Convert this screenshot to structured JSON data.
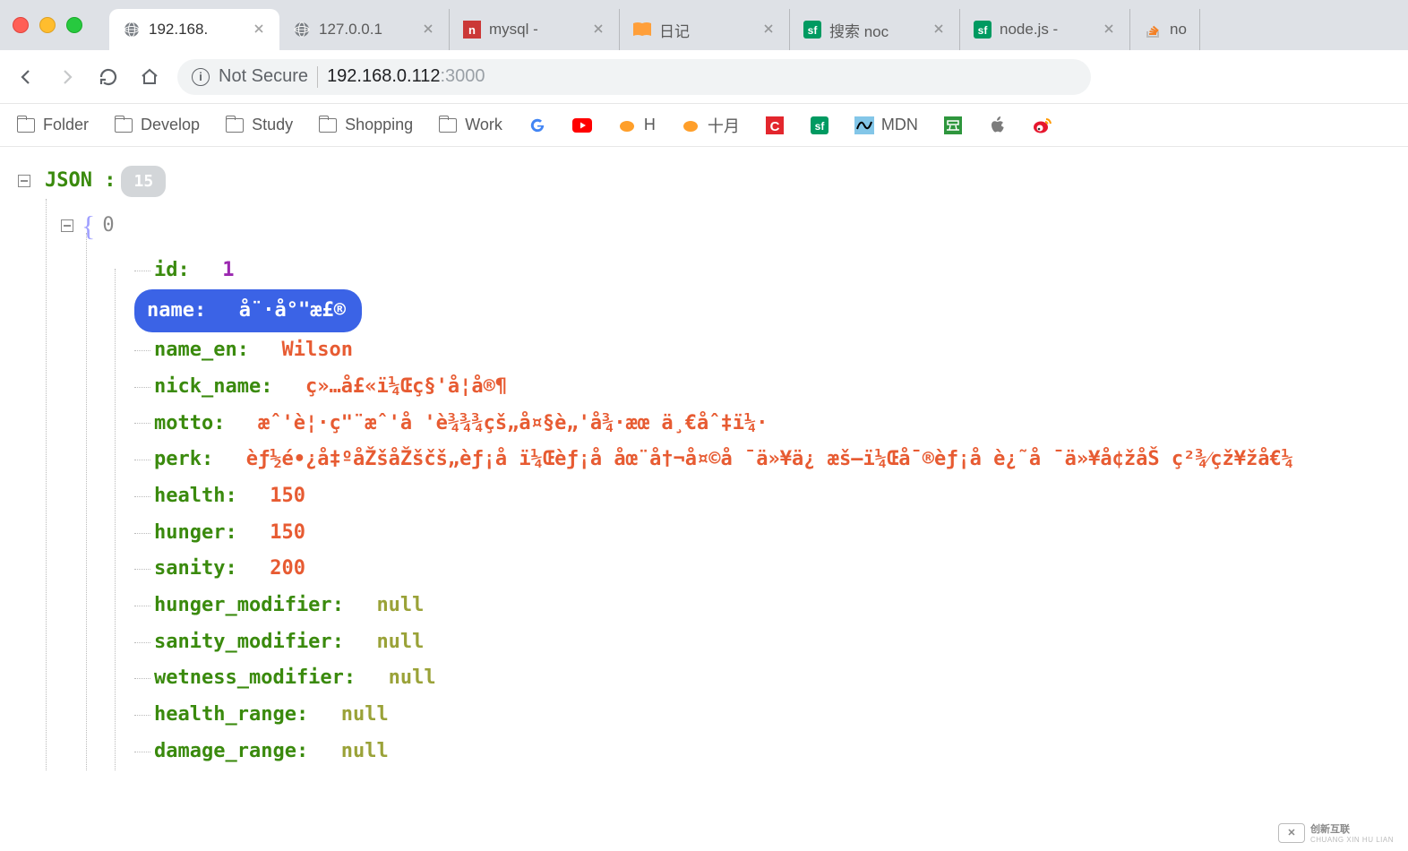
{
  "window": {
    "tabs": [
      {
        "title": "192.168.",
        "active": true,
        "favicon": "globe"
      },
      {
        "title": "127.0.0.1",
        "favicon": "globe"
      },
      {
        "title": "mysql -",
        "favicon": "npm"
      },
      {
        "title": "日记",
        "favicon": "book"
      },
      {
        "title": "搜索 noc",
        "favicon": "sf"
      },
      {
        "title": "node.js -",
        "favicon": "sf"
      },
      {
        "title": "no",
        "favicon": "so",
        "short": true
      }
    ]
  },
  "addressbar": {
    "not_secure": "Not Secure",
    "host": "192.168.0.112",
    "port": ":3000"
  },
  "bookmarks": [
    {
      "label": "Folder",
      "icon": "folder"
    },
    {
      "label": "Develop",
      "icon": "folder"
    },
    {
      "label": "Study",
      "icon": "folder"
    },
    {
      "label": "Shopping",
      "icon": "folder"
    },
    {
      "label": "Work",
      "icon": "folder"
    },
    {
      "label": "",
      "icon": "google"
    },
    {
      "label": "",
      "icon": "youtube"
    },
    {
      "label": "H",
      "icon": "orange"
    },
    {
      "label": "十月",
      "icon": "orange"
    },
    {
      "label": "",
      "icon": "red-c"
    },
    {
      "label": "",
      "icon": "sf"
    },
    {
      "label": "MDN",
      "icon": "mdn"
    },
    {
      "label": "",
      "icon": "douban"
    },
    {
      "label": "",
      "icon": "apple"
    },
    {
      "label": "",
      "icon": "weibo"
    }
  ],
  "json": {
    "root_label": "JSON :",
    "root_count": "15",
    "array_index": "0",
    "selected_key": "name",
    "fields": [
      {
        "key": "id",
        "value": "1",
        "type": "num"
      },
      {
        "key": "name",
        "value": "å¨·å°\"æ£®",
        "type": "str",
        "selected": true
      },
      {
        "key": "name_en",
        "value": "Wilson",
        "type": "str"
      },
      {
        "key": "nick_name",
        "value": "ç»…å£«ï¼Œç§'å¦å®¶",
        "type": "str"
      },
      {
        "key": "motto",
        "value": "æˆ'è¦·ç\"¨æˆ'å   'è¾¾¾çš„å¤§è„'å¾·æœ   ä¸€åˆ‡ï¼·",
        "type": "str"
      },
      {
        "key": "perk",
        "value": "èƒ½é•¿å‡ºåŽšåŽščš„èƒ¡å   ï¼Œèƒ¡å   åœ¨å†¬å¤©å   ¯ä»¥ä¿   æš–ï¼Œå¯®èƒ¡å   è¿˜å   ¯ä»¥å¢žåŠ ç²¾⁄çž¥žå€¼",
        "type": "str"
      },
      {
        "key": "health",
        "value": "150",
        "type": "str"
      },
      {
        "key": "hunger",
        "value": "150",
        "type": "str"
      },
      {
        "key": "sanity",
        "value": "200",
        "type": "str"
      },
      {
        "key": "hunger_modifier",
        "value": "null",
        "type": "null"
      },
      {
        "key": "sanity_modifier",
        "value": "null",
        "type": "null"
      },
      {
        "key": "wetness_modifier",
        "value": "null",
        "type": "null"
      },
      {
        "key": "health_range",
        "value": "null",
        "type": "null"
      },
      {
        "key": "damage_range",
        "value": "null",
        "type": "null"
      }
    ]
  },
  "watermark": {
    "brand": "创新互联",
    "sub": "CHUANG XIN HU LIAN"
  }
}
